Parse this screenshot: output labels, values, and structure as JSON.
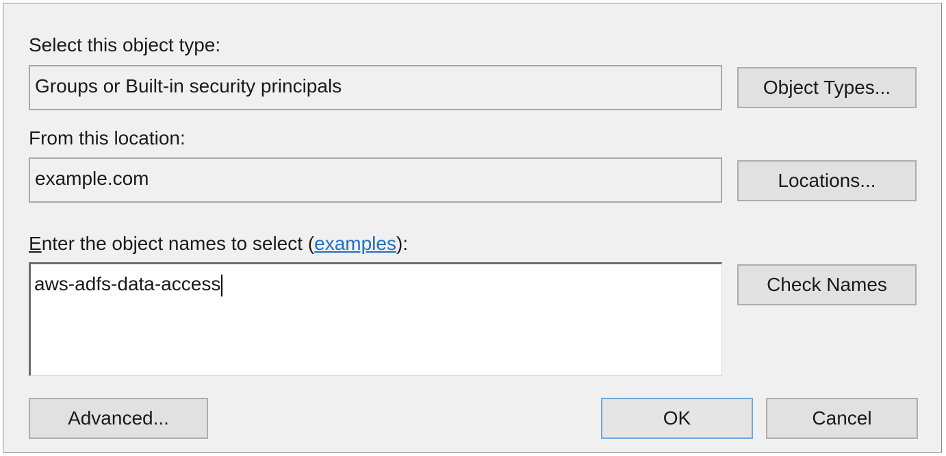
{
  "object_type": {
    "label": "Select this object type:",
    "value": "Groups or Built-in security principals",
    "button": "Object Types..."
  },
  "location": {
    "label": "From this location:",
    "value": "example.com",
    "button": "Locations..."
  },
  "names": {
    "label_accel": "E",
    "label_rest": "nter the object names to select (",
    "link": "examples",
    "label_end": "):",
    "value": "aws-adfs-data-access",
    "button": "Check Names"
  },
  "footer": {
    "advanced": "Advanced...",
    "ok": "OK",
    "cancel": "Cancel"
  },
  "colors": {
    "dialog_bg": "#f0f0f0",
    "link": "#1f6fc5",
    "default_button_border": "#6ea6d8"
  }
}
